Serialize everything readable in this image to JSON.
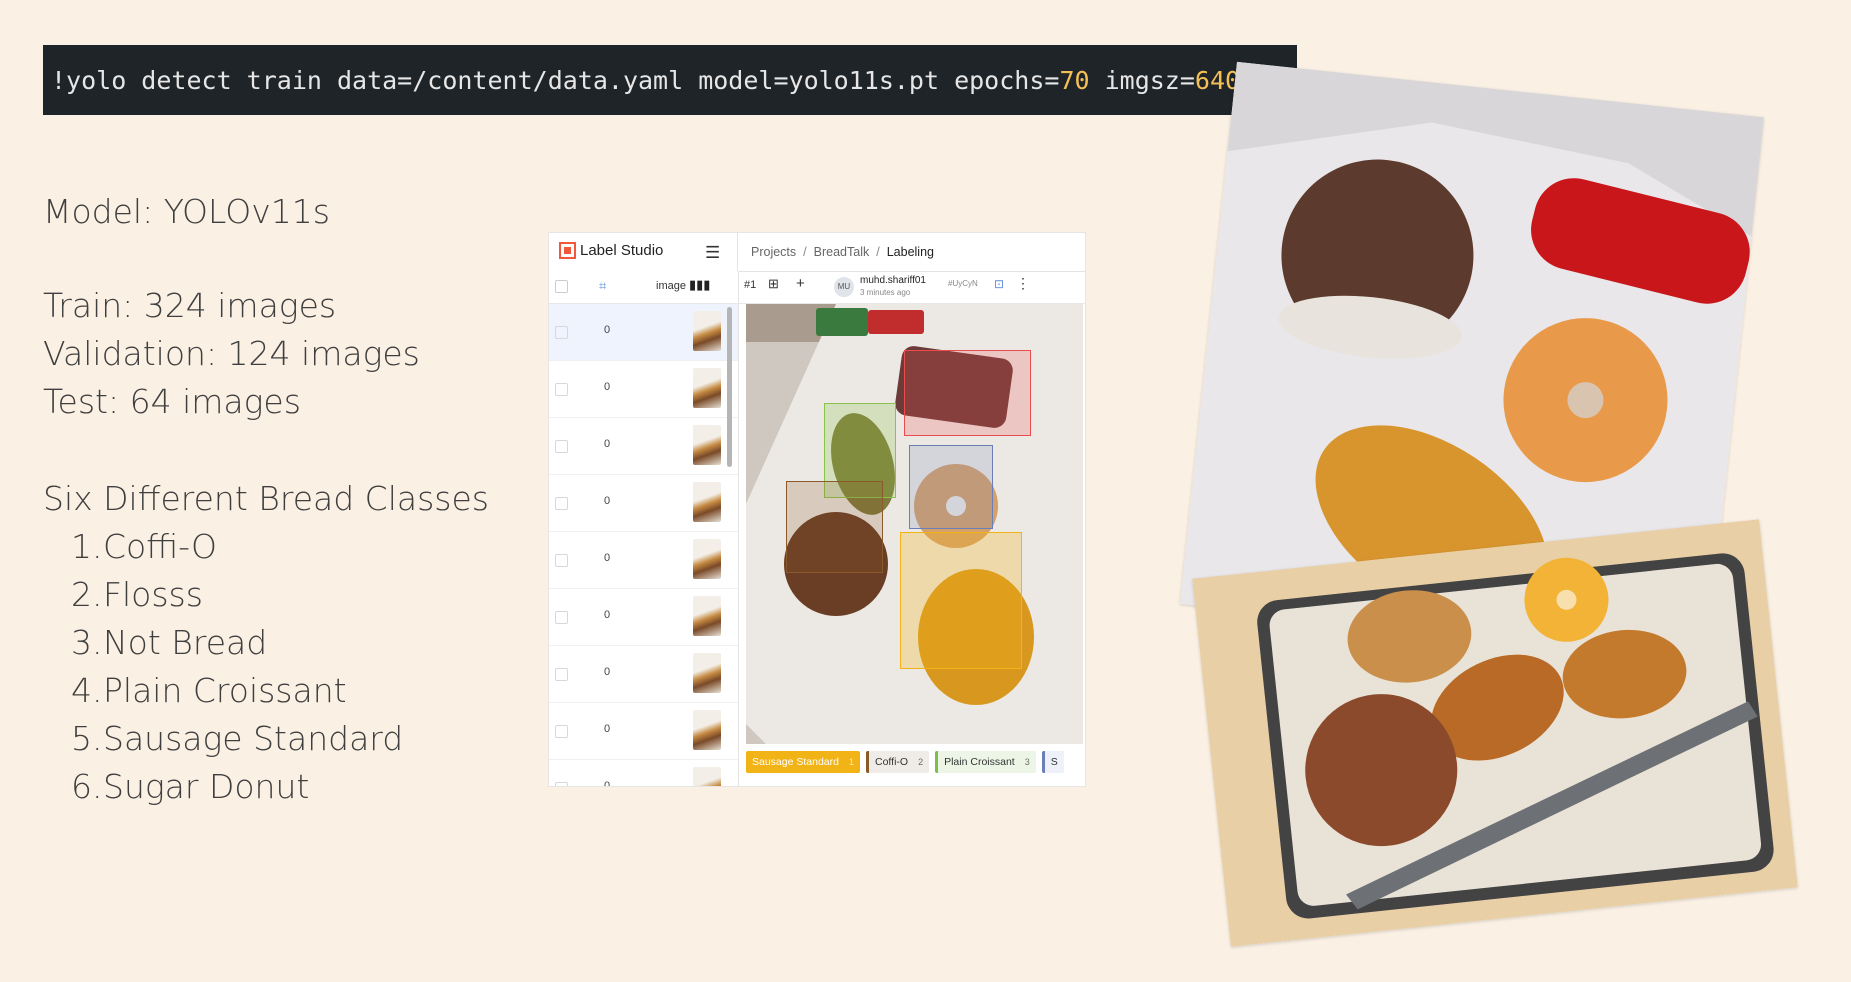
{
  "command": {
    "prefix": "!yolo detect train data=/content/data.yaml model=yolo11s.pt epochs=",
    "epochs": "70",
    "mid": " imgsz=",
    "imgsz": "640"
  },
  "info": {
    "model": "Model: YOLOv11s",
    "train": "Train: 324 images",
    "validation": "Validation: 124 images",
    "test": "Test: 64 images",
    "classes_title": "Six Different Bread Classes",
    "classes": [
      {
        "num": "1.",
        "name": "Coffi-O"
      },
      {
        "num": "2.",
        "name": "Flosss"
      },
      {
        "num": "3.",
        "name": "Not Bread"
      },
      {
        "num": "4.",
        "name": "Plain Croissant"
      },
      {
        "num": "5.",
        "name": "Sausage Standard"
      },
      {
        "num": "6.",
        "name": "Sugar Donut"
      }
    ]
  },
  "label_studio": {
    "app_name": "Label Studio",
    "breadcrumbs": [
      "Projects",
      "BreadTalk",
      "Labeling"
    ],
    "column_image": "image",
    "rows": [
      "0",
      "0",
      "0",
      "0",
      "0",
      "0",
      "0",
      "0",
      "0"
    ],
    "task_id": "#1",
    "avatar": "MU",
    "user": "muhd.shariff01",
    "time": "3 minutes ago",
    "tag": "#UyCyN",
    "labels": [
      {
        "name": "Sausage Standard",
        "key": "1",
        "bg": "#f2b316",
        "fg": "#ffffff"
      },
      {
        "name": "Coffi-O",
        "key": "2",
        "bg": "#efebe6",
        "fg": "#333333",
        "border": "#8a5a2b"
      },
      {
        "name": "Plain Croissant",
        "key": "3",
        "bg": "#edf6e6",
        "fg": "#333333",
        "border": "#7cc04a"
      },
      {
        "name": "S",
        "key": "",
        "bg": "#eef1fa",
        "fg": "#333333",
        "border": "#6a7fb8"
      }
    ],
    "colors": {
      "not_bread": "#e84c4c",
      "plain_croissant": "#8bc34a",
      "sugar_donut": "#6a7fb8",
      "coffi_o": "#8a5a2b",
      "sausage_standard": "#f2b316"
    }
  }
}
